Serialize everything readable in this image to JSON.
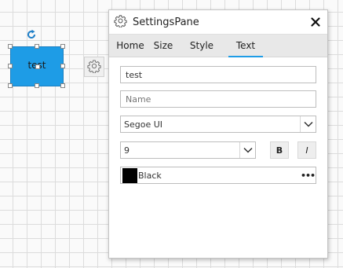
{
  "canvas": {
    "node_label": "test"
  },
  "pane": {
    "title": "SettingsPane",
    "close_label": "✕",
    "tabs": [
      {
        "label": "Home"
      },
      {
        "label": "Size"
      },
      {
        "label": "Style"
      },
      {
        "label": "Text"
      }
    ],
    "active_tab": "Text",
    "text_value": "test",
    "name_placeholder": "Name",
    "font_family": "Segoe UI",
    "font_size": "9",
    "bold_label": "B",
    "italic_label": "I",
    "color_name": "Black",
    "color_hex": "#000000",
    "more_label": "•••"
  },
  "colors": {
    "node_fill": "#1e9ce6",
    "tab_accent": "#1e9ce6"
  },
  "icons": [
    "rotate-icon",
    "gear-icon",
    "settings-icon",
    "close-icon",
    "chevron-down-icon"
  ]
}
